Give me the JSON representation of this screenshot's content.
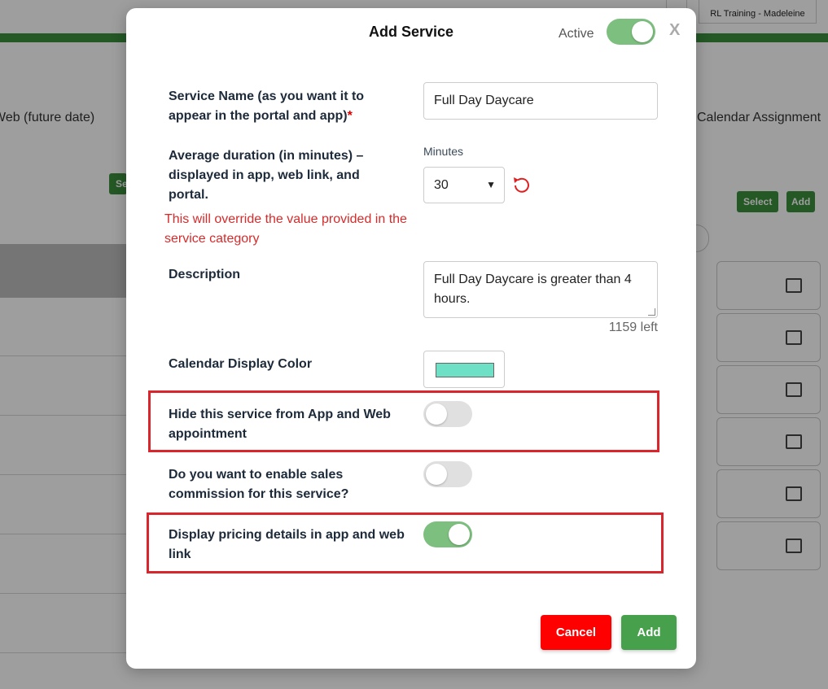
{
  "background": {
    "user_card": "RL Training - Madeleine",
    "web_future_date": "Web (future date)",
    "calendar_assignment": "Calendar Assignment",
    "select_button": "Select",
    "add_button": "Add",
    "small_button": "Se"
  },
  "modal": {
    "title": "Add Service",
    "active_label": "Active",
    "active_on": true,
    "close": "X",
    "service_name_label": "Service Name (as you want it to appear in the portal and app)",
    "required_mark": "*",
    "service_name_value": "Full Day Daycare",
    "duration_label": "Average duration (in minutes) – displayed in app, web link, and portal.",
    "minutes_caption": "Minutes",
    "duration_value": "30",
    "override_warning": "This will override the value provided in the service category",
    "description_label": "Description",
    "description_value": "Full Day Daycare is greater than 4 hours.",
    "chars_left": "1159 left",
    "color_label": "Calendar Display Color",
    "color_value": "#6de0c6",
    "hide_label": "Hide this service from App and Web appointment",
    "hide_on": false,
    "commission_label": "Do you want to enable sales commission for this service?",
    "commission_on": false,
    "pricing_label": "Display pricing details in app and web link",
    "pricing_on": true,
    "cancel_label": "Cancel",
    "add_label": "Add"
  }
}
